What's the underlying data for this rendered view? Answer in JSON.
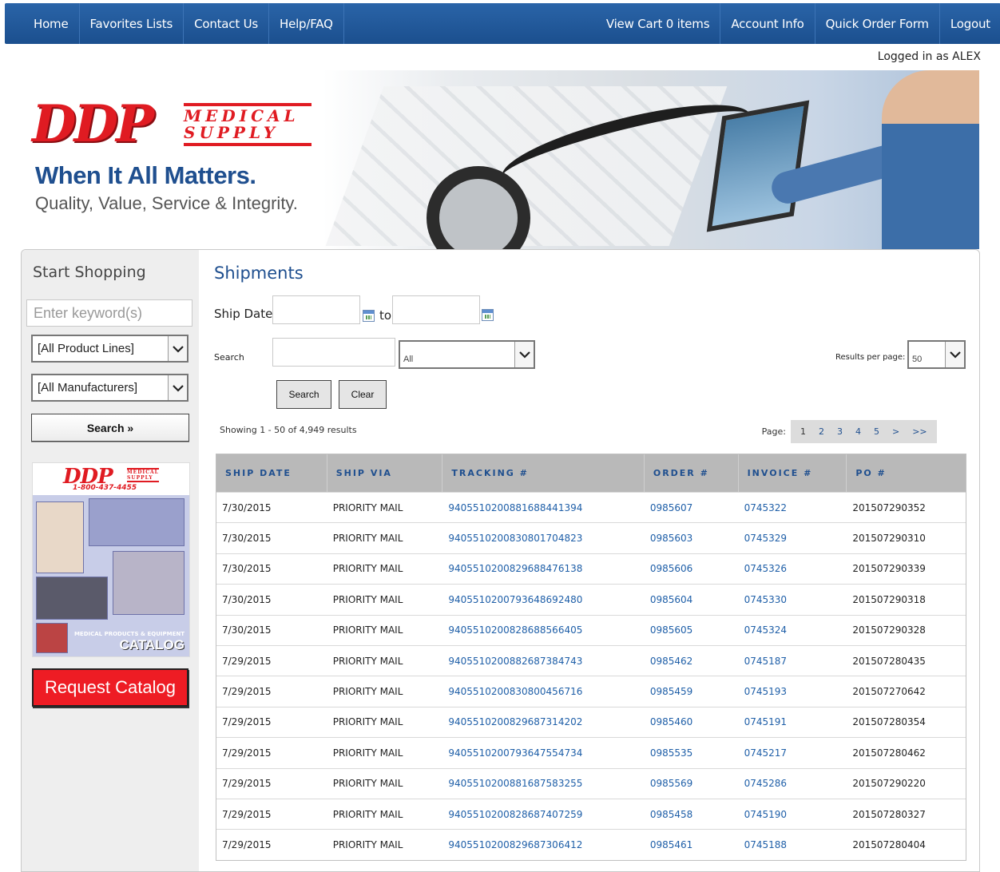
{
  "nav": {
    "left": [
      "Home",
      "Favorites Lists",
      "Contact Us",
      "Help/FAQ"
    ],
    "right": [
      "View Cart 0 items",
      "Account Info",
      "Quick Order Form",
      "Logout"
    ]
  },
  "logged_in": "Logged in as ALEX",
  "banner": {
    "logo_main": "DDP",
    "logo_line1": "MEDICAL",
    "logo_line2": "SUPPLY",
    "tagline": "When It All Matters.",
    "subtagline": "Quality, Value, Service & Integrity."
  },
  "sidebar": {
    "title": "Start Shopping",
    "keyword_placeholder": "Enter keyword(s)",
    "product_lines": "[All Product Lines]",
    "manufacturers": "[All Manufacturers]",
    "search_label": "Search »",
    "catalog": {
      "brand": "DDP",
      "brand_sub": "MEDICAL SUPPLY",
      "phone": "1-800-437-4455",
      "sub": "MEDICAL PRODUCTS & EQUIPMENT",
      "label": "CATALOG"
    },
    "request_catalog": "Request Catalog"
  },
  "content": {
    "title": "Shipments",
    "ship_date_label": "Ship Date:",
    "to_label": "to",
    "search_label": "Search",
    "filter_value": "All",
    "results_per_page_label": "Results per page:",
    "results_per_page": "50",
    "search_button": "Search",
    "clear_button": "Clear",
    "showing": "Showing 1 - 50 of 4,949 results",
    "page_label": "Page:",
    "pages": [
      "1",
      "2",
      "3",
      "4",
      "5",
      ">",
      ">>"
    ]
  },
  "table": {
    "headers": [
      "SHIP DATE",
      "SHIP VIA",
      "TRACKING #",
      "ORDER #",
      "INVOICE #",
      "PO #"
    ],
    "rows": [
      [
        "7/30/2015",
        "PRIORITY MAIL",
        "9405510200881688441394",
        "0985607",
        "0745322",
        "201507290352"
      ],
      [
        "7/30/2015",
        "PRIORITY MAIL",
        "9405510200830801704823",
        "0985603",
        "0745329",
        "201507290310"
      ],
      [
        "7/30/2015",
        "PRIORITY MAIL",
        "9405510200829688476138",
        "0985606",
        "0745326",
        "201507290339"
      ],
      [
        "7/30/2015",
        "PRIORITY MAIL",
        "9405510200793648692480",
        "0985604",
        "0745330",
        "201507290318"
      ],
      [
        "7/30/2015",
        "PRIORITY MAIL",
        "9405510200828688566405",
        "0985605",
        "0745324",
        "201507290328"
      ],
      [
        "7/29/2015",
        "PRIORITY MAIL",
        "9405510200882687384743",
        "0985462",
        "0745187",
        "201507280435"
      ],
      [
        "7/29/2015",
        "PRIORITY MAIL",
        "9405510200830800456716",
        "0985459",
        "0745193",
        "201507270642"
      ],
      [
        "7/29/2015",
        "PRIORITY MAIL",
        "9405510200829687314202",
        "0985460",
        "0745191",
        "201507280354"
      ],
      [
        "7/29/2015",
        "PRIORITY MAIL",
        "9405510200793647554734",
        "0985535",
        "0745217",
        "201507280462"
      ],
      [
        "7/29/2015",
        "PRIORITY MAIL",
        "9405510200881687583255",
        "0985569",
        "0745286",
        "201507290220"
      ],
      [
        "7/29/2015",
        "PRIORITY MAIL",
        "9405510200828687407259",
        "0985458",
        "0745190",
        "201507280327"
      ],
      [
        "7/29/2015",
        "PRIORITY MAIL",
        "9405510200829687306412",
        "0985461",
        "0745188",
        "201507280404"
      ]
    ]
  },
  "icons": {
    "calendar": "calendar-icon",
    "dropdown": "chevron-down-icon"
  },
  "colors": {
    "nav_bg": "#1f56a0",
    "link": "#1f5fa8",
    "title": "#1f4f8f",
    "request_btn": "#ee1c24",
    "brand_red": "#e01b22"
  }
}
